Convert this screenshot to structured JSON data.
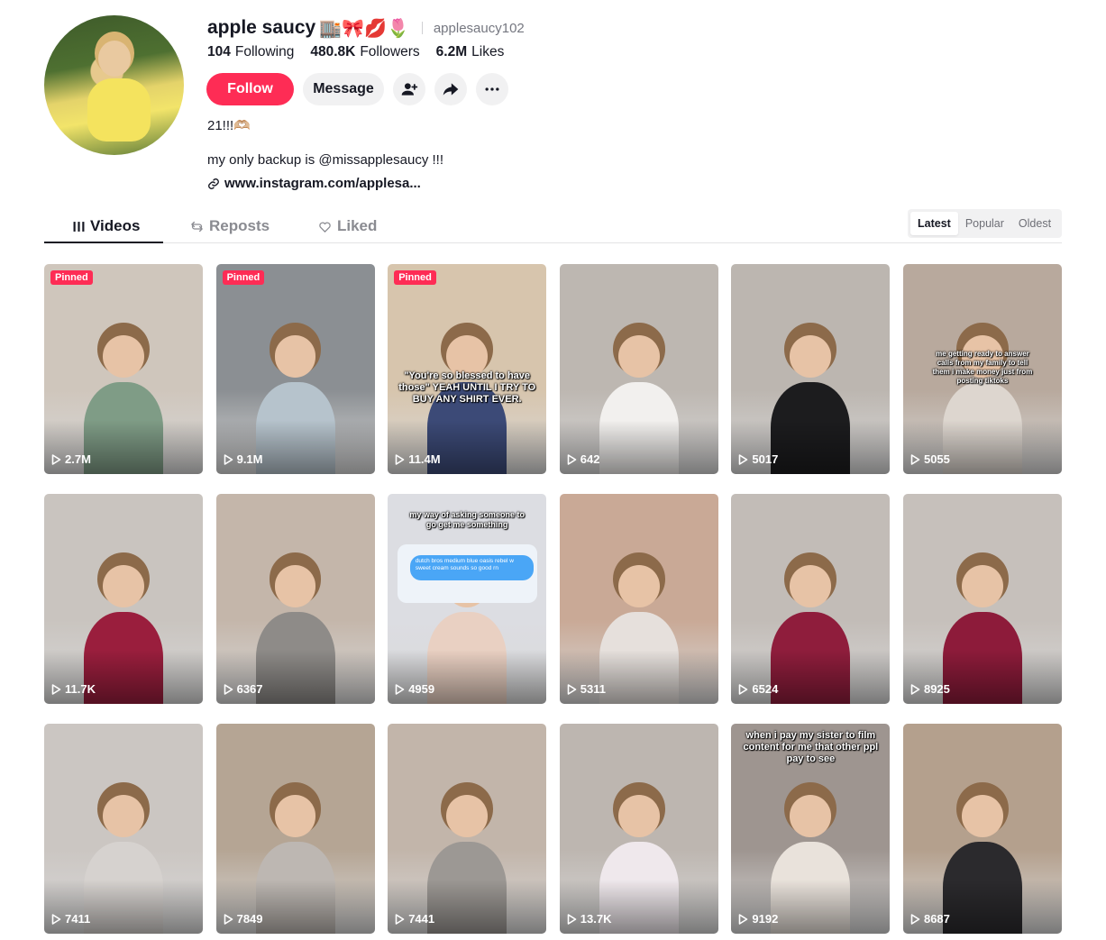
{
  "profile": {
    "display_name": "apple saucy",
    "emoji": "🏬🎀💋🌷",
    "username": "applesaucy102",
    "following_count": "104",
    "following_label": "Following",
    "followers_count": "480.8K",
    "followers_label": "Followers",
    "likes_count": "6.2M",
    "likes_label": "Likes",
    "bio_line1": "21!!!🫶🏼",
    "bio_line2": "my only backup is @missapplesaucy !!!",
    "link": "www.instagram.com/applesa..."
  },
  "actions": {
    "follow_label": "Follow",
    "message_label": "Message",
    "icons": [
      "add-friend-icon",
      "share-icon",
      "more-icon"
    ]
  },
  "tabs": {
    "videos": "Videos",
    "reposts": "Reposts",
    "liked": "Liked"
  },
  "sort": {
    "latest": "Latest",
    "popular": "Popular",
    "oldest": "Oldest",
    "selected": "Latest"
  },
  "videos": [
    {
      "views": "2.7M",
      "pinned": "Pinned",
      "bg": "#cfc6bc",
      "shirt": "#7f9c86"
    },
    {
      "views": "9.1M",
      "pinned": "Pinned",
      "bg": "#8b8f93",
      "shirt": "#b6c3cc"
    },
    {
      "views": "11.4M",
      "pinned": "Pinned",
      "bg": "#d7c5ad",
      "shirt": "#3c4a77",
      "caption": "\"You're so blessed to have those\" YEAH UNTIL I TRY TO BUY ANY SHIRT EVER."
    },
    {
      "views": "642",
      "bg": "#bdb7b1",
      "shirt": "#f2f0ee"
    },
    {
      "views": "5017",
      "bg": "#bcb6b0",
      "shirt": "#1c1c1e"
    },
    {
      "views": "5055",
      "bg": "#b8a99d",
      "shirt": "#ddd6cf",
      "caption": "me getting ready to answer calls from my family to tell them i make money just from posting tiktoks"
    },
    {
      "views": "11.7K",
      "bg": "#c9c4bf",
      "shirt": "#9a1e3d"
    },
    {
      "views": "6367",
      "bg": "#c4b6aa",
      "shirt": "#8e8b88"
    },
    {
      "views": "4959",
      "bg": "#dcdde2",
      "shirt": "#e9d0c2",
      "caption": "my way of asking someone to go get me something",
      "chat": "dutch bros medium blue oasis rebel w sweet cream sounds so good rn"
    },
    {
      "views": "5311",
      "bg": "#c9a996",
      "shirt": "#e6e0dc"
    },
    {
      "views": "6524",
      "bg": "#c2bcb7",
      "shirt": "#8f1d3c"
    },
    {
      "views": "8925",
      "bg": "#c6c0bb",
      "shirt": "#8d1b3a"
    },
    {
      "views": "7411",
      "bg": "#cbc6c2",
      "shirt": "#d6d2cf"
    },
    {
      "views": "7849",
      "bg": "#b5a594",
      "shirt": "#bdb7b2"
    },
    {
      "views": "7441",
      "bg": "#c2b5aa",
      "shirt": "#9c9894"
    },
    {
      "views": "13.7K",
      "bg": "#bdb6b0",
      "shirt": "#efe8ec"
    },
    {
      "views": "9192",
      "bg": "#9e9590",
      "shirt": "#e9e2db",
      "caption": "when i pay my sister to film content for me that other ppl pay to see"
    },
    {
      "views": "8687",
      "bg": "#b4a08d",
      "shirt": "#2b2a2d"
    }
  ]
}
